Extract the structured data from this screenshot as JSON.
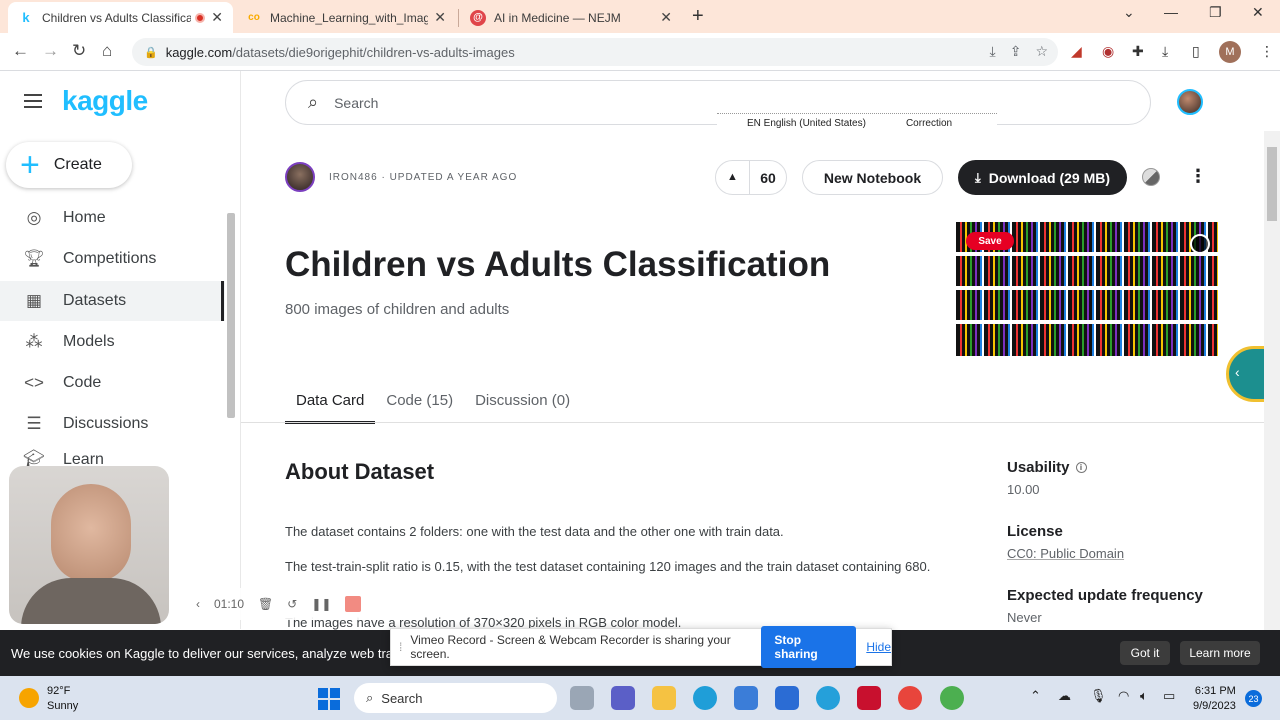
{
  "browser": {
    "tabs": [
      {
        "title": "Children vs Adults Classificati",
        "favicon": "k"
      },
      {
        "title": "Machine_Learning_with_Image_C",
        "favicon": "co"
      },
      {
        "title": "AI in Medicine — NEJM",
        "favicon": "@"
      }
    ],
    "new_tab": "+",
    "url_host": "kaggle.com",
    "url_path": "/datasets/die9origephit/children-vs-adults-images",
    "profile_initial": "M"
  },
  "sidebar": {
    "logo": "kaggle",
    "create_label": "Create",
    "items": [
      {
        "label": "Home",
        "icon": "compass-icon"
      },
      {
        "label": "Competitions",
        "icon": "trophy-icon"
      },
      {
        "label": "Datasets",
        "icon": "table-icon"
      },
      {
        "label": "Models",
        "icon": "models-icon"
      },
      {
        "label": "Code",
        "icon": "code-icon"
      },
      {
        "label": "Discussions",
        "icon": "discussion-icon"
      },
      {
        "label": "Learn",
        "icon": "learn-icon"
      }
    ]
  },
  "search": {
    "placeholder": "Search"
  },
  "translate_bar": {
    "language": "EN English (United States)",
    "correction": "Correction"
  },
  "dataset": {
    "owner_line": "IRON486 · UPDATED A YEAR AGO",
    "votes": "60",
    "new_notebook": "New Notebook",
    "download": "Download (29 MB)",
    "title": "Children vs Adults Classification",
    "subtitle": "800 images of children and adults",
    "pin_save": "Save",
    "tabs": [
      "Data Card",
      "Code (15)",
      "Discussion (0)"
    ],
    "about_heading": "About Dataset",
    "paragraphs": [
      "The dataset contains 2 folders: one with the test data and the other one with train data.",
      "The test-train-split ratio is 0.15, with the test dataset containing 120 images and the train dataset containing 680.",
      "The images have a resolution of 370×320 pixels in RGB color model."
    ]
  },
  "meta": {
    "usability_label": "Usability",
    "usability_value": "10.00",
    "license_label": "License",
    "license_value": "CC0: Public Domain",
    "frequency_label": "Expected update frequency",
    "frequency_value": "Never"
  },
  "recorder": {
    "time": "01:10"
  },
  "cookie": {
    "message": "We use cookies on Kaggle to deliver our services, analyze web traffic, a",
    "got_it": "Got it",
    "learn_more": "Learn more"
  },
  "vimeo": {
    "message": "Vimeo Record - Screen & Webcam Recorder is sharing your screen.",
    "stop": "Stop sharing",
    "hide": "Hide"
  },
  "taskbar": {
    "temperature": "92°F",
    "condition": "Sunny",
    "search": "Search",
    "time": "6:31 PM",
    "date": "9/9/2023",
    "notifications": "23"
  },
  "colors": {
    "kaggle_blue": "#20beff",
    "dark_button": "#202124",
    "accent_blue": "#1a73e8"
  }
}
